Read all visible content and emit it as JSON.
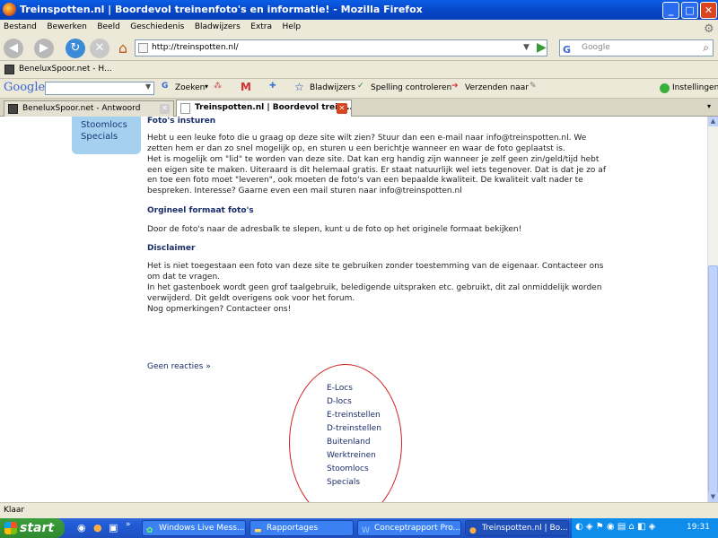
{
  "window": {
    "title": "Treinspotten.nl | Boordevol treinenfoto's en informatie! - Mozilla Firefox",
    "icon": "firefox-icon"
  },
  "menu": [
    "Bestand",
    "Bewerken",
    "Beeld",
    "Geschiedenis",
    "Bladwijzers",
    "Extra",
    "Help"
  ],
  "nav": {
    "url": "http://treinspotten.nl/",
    "search_placeholder": "Google"
  },
  "bookmarks": {
    "item1": "BeneluxSpoor.net - H..."
  },
  "google_toolbar": {
    "logo": "Google",
    "zoeken": "Zoeken",
    "bladwijzers": "Bladwijzers",
    "spelling": "Spelling controleren",
    "verzenden": "Verzenden naar",
    "instellingen": "Instellingen"
  },
  "tabs": [
    {
      "label": "BeneluxSpoor.net - Antwoord"
    },
    {
      "label": "Treinspotten.nl | Boordevol trein..."
    }
  ],
  "sidebar": {
    "items": [
      "Stoomlocs",
      "Specials"
    ]
  },
  "page": {
    "h1": "Foto's insturen",
    "p1": "Hebt u een leuke foto die u graag op deze site wilt zien? Stuur dan een e-mail naar info@treinspotten.nl. We zetten hem er dan zo snel mogelijk op, en sturen u een berichtje wanneer en waar de foto geplaatst is.",
    "p2": "Het is mogelijk om \"lid\" te worden van deze site. Dat kan erg handig zijn wanneer je zelf geen zin/geld/tijd hebt een eigen site te maken. Uiteraard is dit helemaal gratis. Er staat natuurlijk wel iets tegenover. Dat is dat je zo af en toe een foto moet \"leveren\", ook moeten de foto's van een bepaalde kwaliteit. De kwaliteit valt nader te bespreken. Interesse? Gaarne even een mail sturen naar info@treinspotten.nl",
    "h2": "Orgineel formaat foto's",
    "p3": "Door de foto's naar de adresbalk te slepen, kunt u de foto op het originele formaat bekijken!",
    "h3": "Disclaimer",
    "p4": "Het is niet toegestaan een foto van deze site te gebruiken zonder toestemming van de eigenaar. Contacteer ons om dat te vragen.",
    "p5": "In het gastenboek wordt geen grof taalgebruik, beledigende uitspraken etc. gebruikt, dit zal onmiddelijk worden verwijderd. Dit geldt overigens ook voor het forum.",
    "p6": "Nog opmerkingen? Contacteer ons!",
    "reacties": "Geen reacties »"
  },
  "categories": [
    "E-Locs",
    "D-locs",
    "E-treinstellen",
    "D-treinstellen",
    "Buitenland",
    "Werktreinen",
    "Stoomlocs",
    "Specials"
  ],
  "status": "Klaar",
  "taskbar": {
    "start": "start",
    "tasks": [
      "Windows Live Mess...",
      "Rapportages",
      "Conceptrapport Pro...",
      "Treinspotten.nl | Bo..."
    ],
    "clock": "19:31"
  },
  "colors": {
    "accent": "#0a5fe6",
    "annotation": "#d02020",
    "sidebar": "#a6d0f0"
  }
}
